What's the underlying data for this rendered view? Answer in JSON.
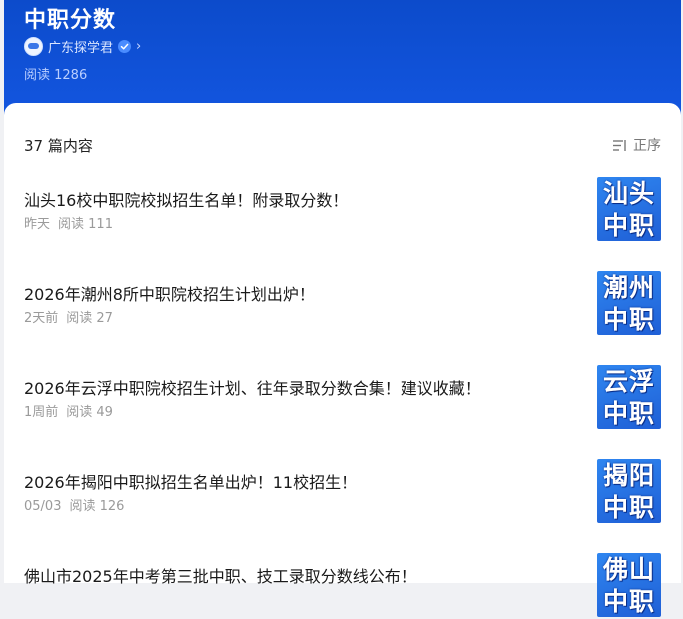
{
  "header": {
    "title": "中职分数",
    "author": "广东探学君",
    "read_count": "阅读 1286"
  },
  "list": {
    "count_label": "37 篇内容",
    "sort_label": "正序",
    "items": [
      {
        "title": "汕头16校中职院校拟招生名单！附录取分数！",
        "time": "昨天",
        "reads": "阅读 111",
        "thumb_line1": "汕头",
        "thumb_line2": "中职"
      },
      {
        "title": "2026年潮州8所中职院校招生计划出炉！",
        "time": "2天前",
        "reads": "阅读 27",
        "thumb_line1": "潮州",
        "thumb_line2": "中职"
      },
      {
        "title": "2026年云浮中职院校招生计划、往年录取分数合集！建议收藏！",
        "time": "1周前",
        "reads": "阅读 49",
        "thumb_line1": "云浮",
        "thumb_line2": "中职"
      },
      {
        "title": "2026年揭阳中职拟招生名单出炉！11校招生！",
        "time": "05/03",
        "reads": "阅读 126",
        "thumb_line1": "揭阳",
        "thumb_line2": "中职"
      },
      {
        "title": "佛山市2025年中考第三批中职、技工录取分数线公布！",
        "time": "",
        "reads": "",
        "thumb_line1": "佛山",
        "thumb_line2": "中职"
      }
    ]
  },
  "colors": {
    "header_blue": "#0c4bcb",
    "thumb_blue": "#2f86f0",
    "verified_blue": "#4a8cff"
  },
  "icons": [
    "avatar",
    "verified-icon",
    "chevron-right-icon",
    "sort-icon"
  ]
}
